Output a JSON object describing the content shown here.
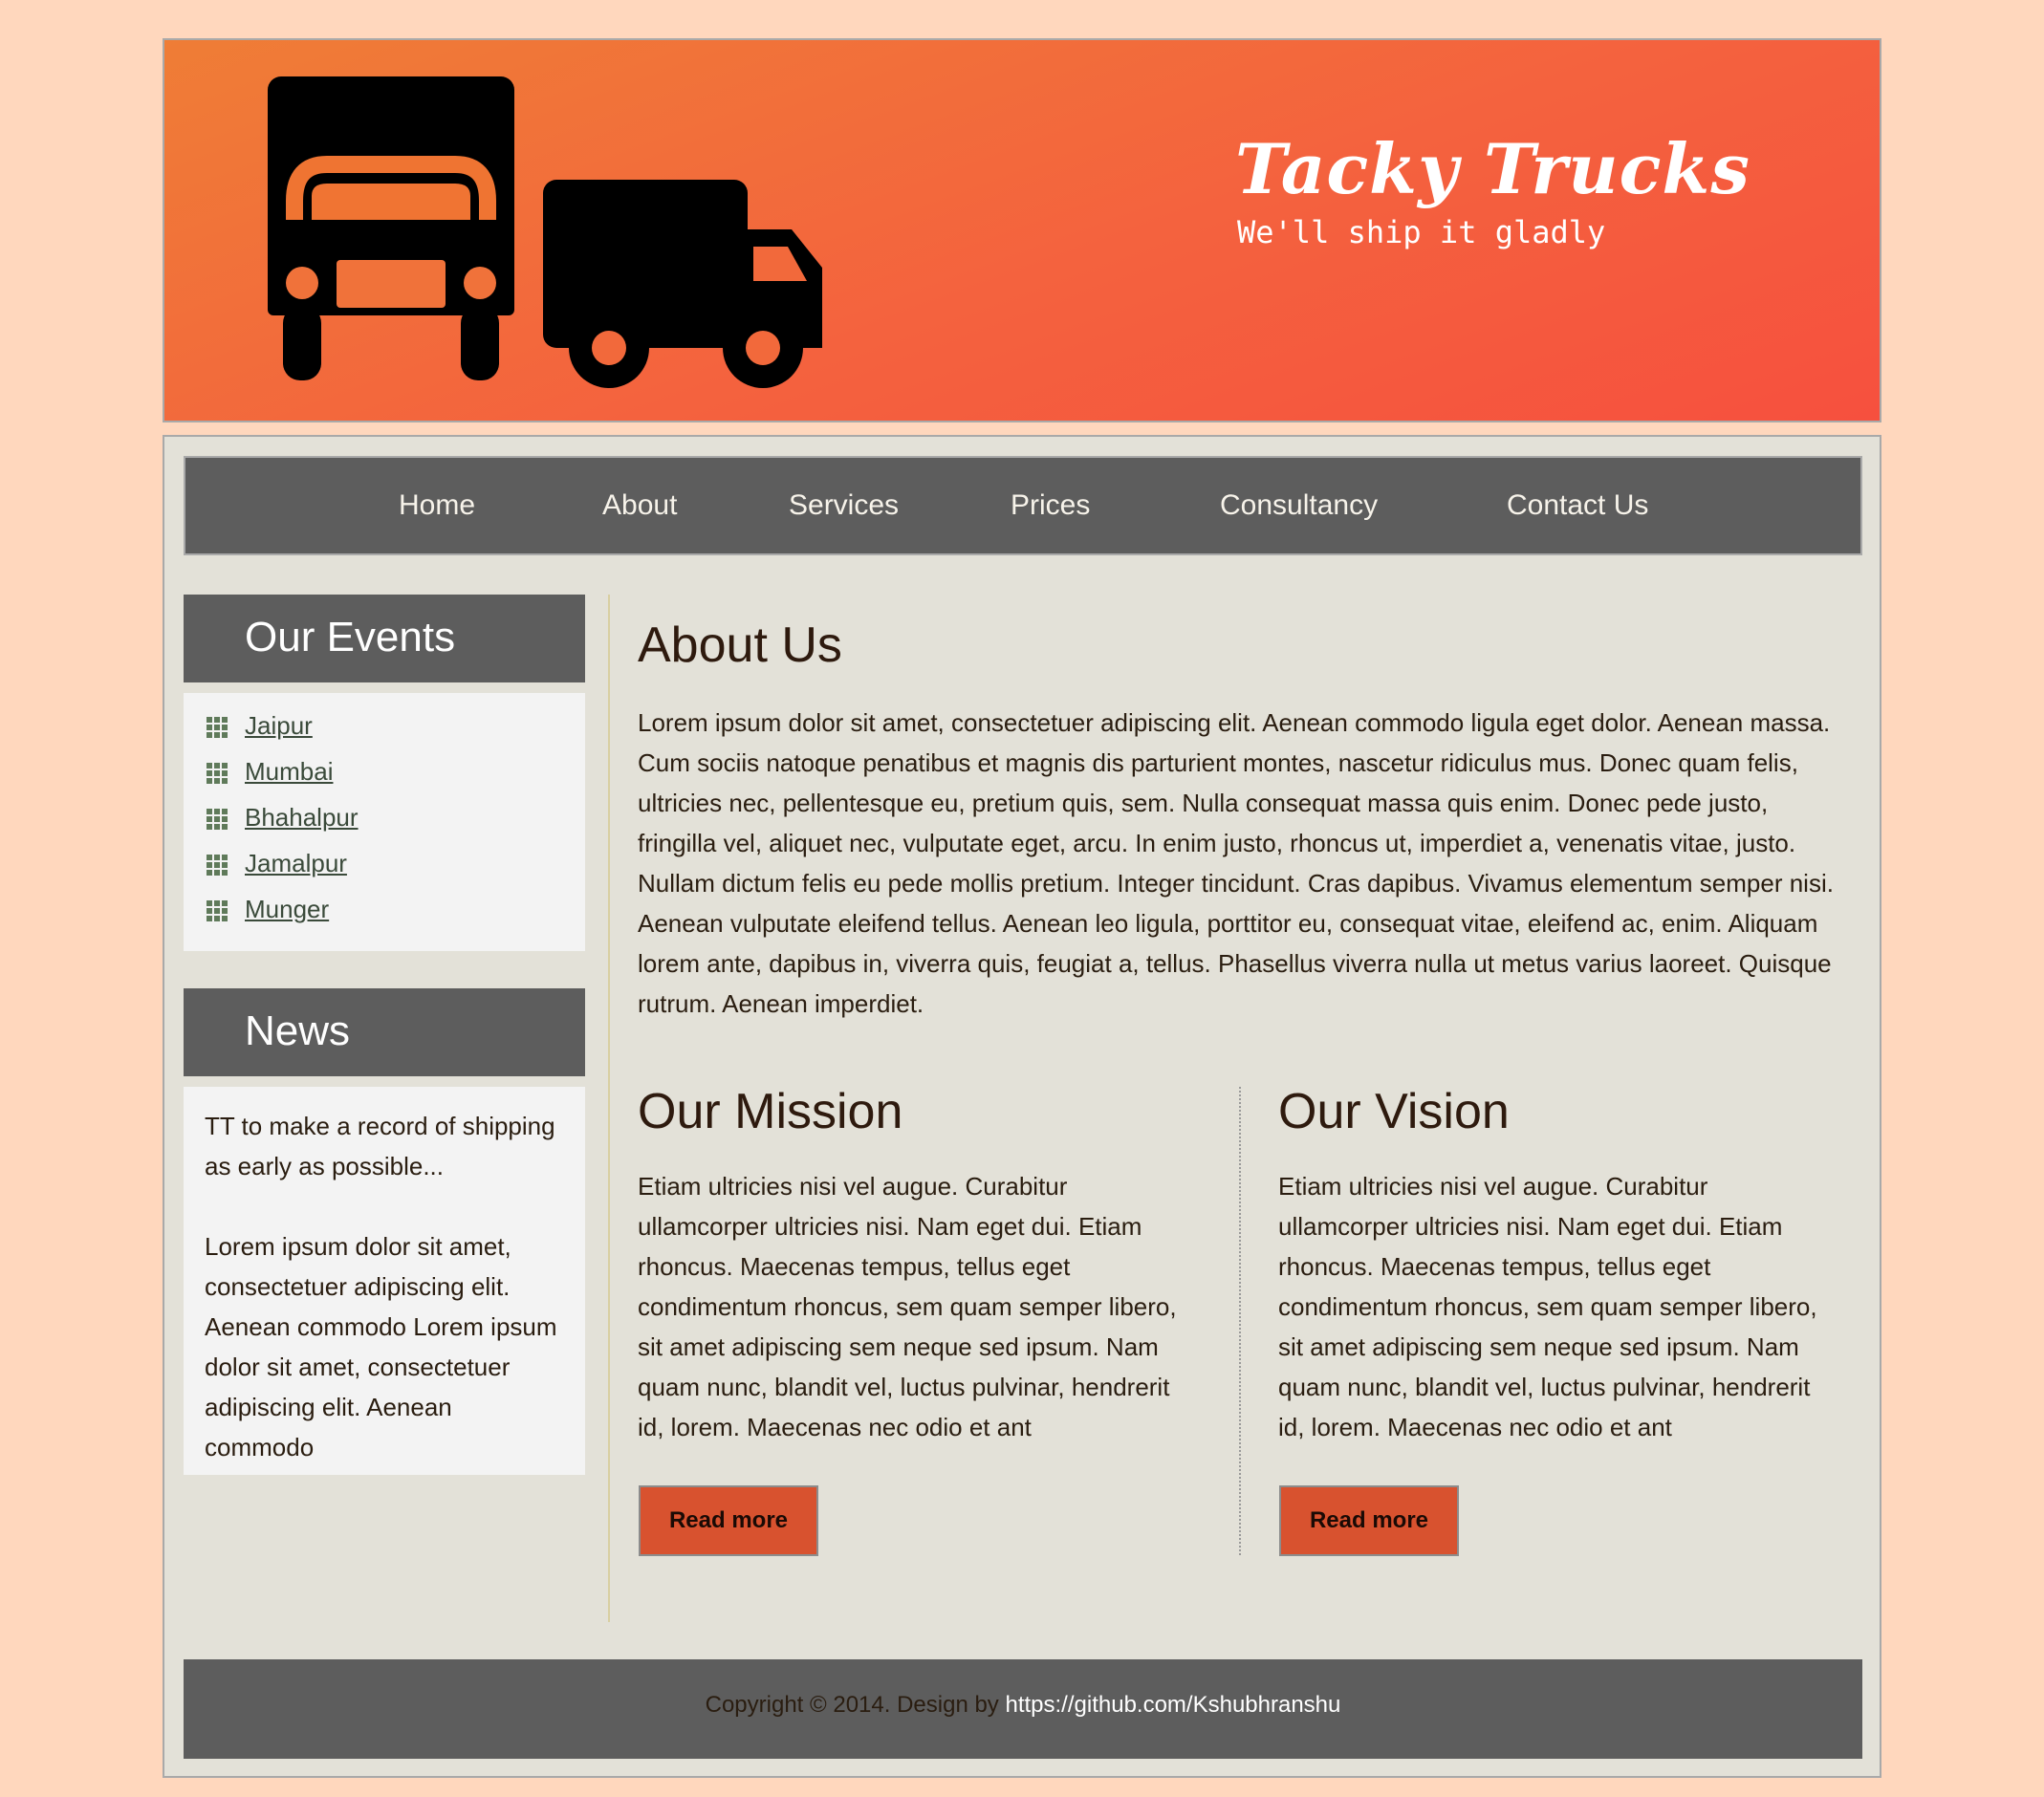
{
  "header": {
    "title": "Tacky Trucks",
    "tagline": "We'll ship it gladly",
    "logo_icon": "trucks-logo-icon"
  },
  "nav": {
    "items": [
      {
        "label": "Home"
      },
      {
        "label": "About"
      },
      {
        "label": "Services"
      },
      {
        "label": "Prices"
      },
      {
        "label": "Consultancy"
      },
      {
        "label": "Contact Us"
      }
    ]
  },
  "sidebar": {
    "events": {
      "title": "Our Events",
      "items": [
        "Jaipur",
        "Mumbai",
        "Bhahalpur",
        "Jamalpur",
        "Munger"
      ]
    },
    "news": {
      "title": "News",
      "headline": "TT to make a record of shipping as early as possible...",
      "body": "Lorem ipsum dolor sit amet, consectetuer adipiscing elit. Aenean commodo Lorem ipsum dolor sit amet, consectetuer adipiscing elit. Aenean commodo"
    }
  },
  "main": {
    "about": {
      "title": "About Us",
      "text": "Lorem ipsum dolor sit amet, consectetuer adipiscing elit. Aenean commodo ligula eget dolor. Aenean massa. Cum sociis natoque penatibus et magnis dis parturient montes, nascetur ridiculus mus. Donec quam felis, ultricies nec, pellentesque eu, pretium quis, sem. Nulla consequat massa quis enim. Donec pede justo, fringilla vel, aliquet nec, vulputate eget, arcu. In enim justo, rhoncus ut, imperdiet a, venenatis vitae, justo. Nullam dictum felis eu pede mollis pretium. Integer tincidunt. Cras dapibus. Vivamus elementum semper nisi. Aenean vulputate eleifend tellus. Aenean leo ligula, porttitor eu, consequat vitae, eleifend ac, enim. Aliquam lorem ante, dapibus in, viverra quis, feugiat a, tellus. Phasellus viverra nulla ut metus varius laoreet. Quisque rutrum. Aenean imperdiet."
    },
    "mission": {
      "title": "Our Mission",
      "text": "Etiam ultricies nisi vel augue. Curabitur ullamcorper ultricies nisi. Nam eget dui. Etiam rhoncus. Maecenas tempus, tellus eget condimentum rhoncus, sem quam semper libero, sit amet adipiscing sem neque sed ipsum. Nam quam nunc, blandit vel, luctus pulvinar, hendrerit id, lorem. Maecenas nec odio et ant",
      "button": "Read more"
    },
    "vision": {
      "title": "Our Vision",
      "text": "Etiam ultricies nisi vel augue. Curabitur ullamcorper ultricies nisi. Nam eget dui. Etiam rhoncus. Maecenas tempus, tellus eget condimentum rhoncus, sem quam semper libero, sit amet adipiscing sem neque sed ipsum. Nam quam nunc, blandit vel, luctus pulvinar, hendrerit id, lorem. Maecenas nec odio et ant",
      "button": "Read more"
    }
  },
  "footer": {
    "copyright": "Copyright © 2014. Design by",
    "link": "https://github.com/Kshubhranshu"
  },
  "colors": {
    "page_background": "#ffd7bd",
    "header_gradient_start": "#ef7d36",
    "header_gradient_end": "#f6503e",
    "nav_background": "#5d5d5d",
    "content_background": "#e3e1d8",
    "button_background": "#d8522f"
  }
}
